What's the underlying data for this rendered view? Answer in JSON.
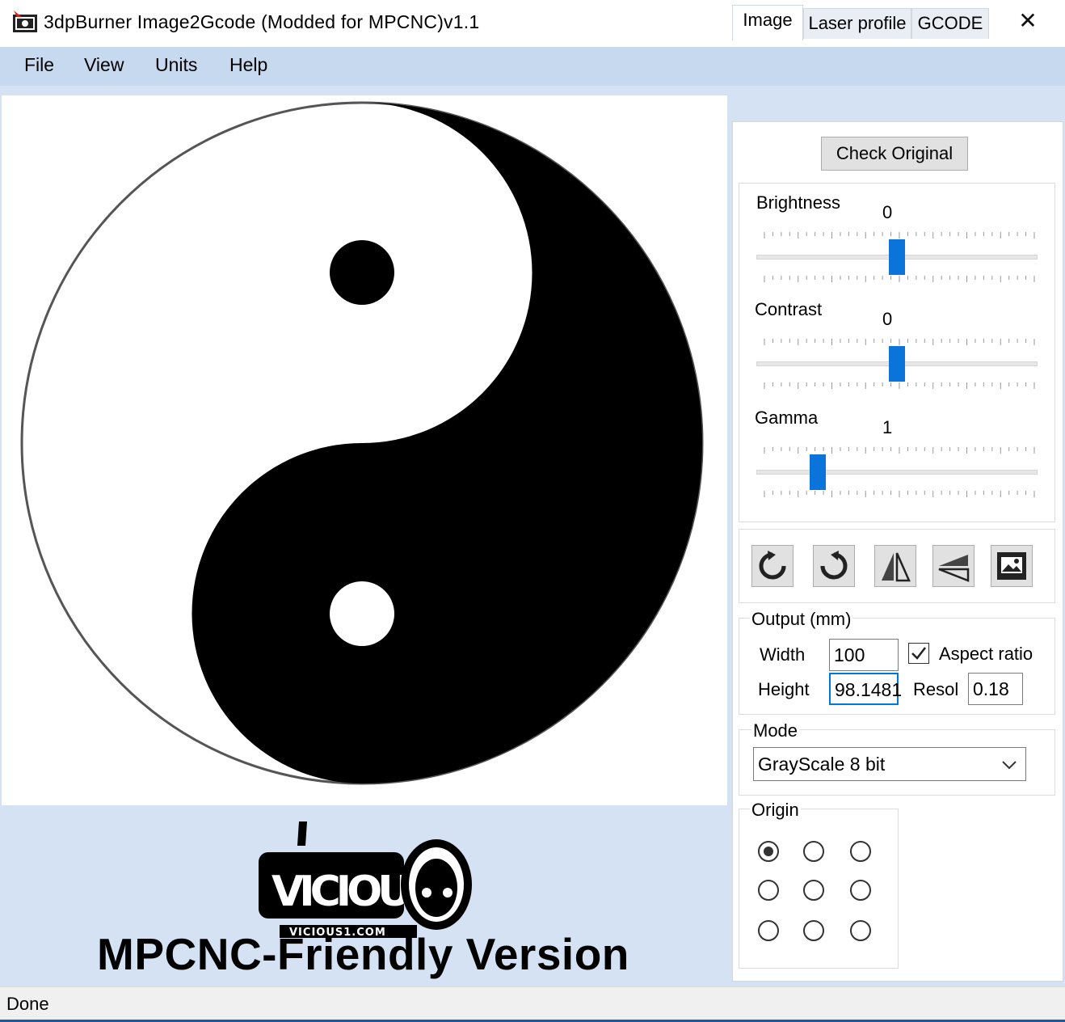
{
  "window": {
    "title": "3dpBurner Image2Gcode (Modded for MPCNC)v1.1",
    "minimize_glyph": "—",
    "maximize_glyph": "☐",
    "close_glyph": "✕",
    "icon": "app-icon"
  },
  "menu": [
    "File",
    "View",
    "Units",
    "Help"
  ],
  "canvas": {
    "image": "yin-yang-icon",
    "brand_logo": "vicious1-logo",
    "brand_logo_text": "VICIOUS1.COM",
    "brand_text": "MPCNC-Friendly Version"
  },
  "tabs": [
    {
      "label": "Image",
      "active": true
    },
    {
      "label": "Laser profile",
      "active": false
    },
    {
      "label": "GCODE",
      "active": false
    }
  ],
  "image_tab": {
    "check_original_label": "Check Original",
    "adjustments": [
      {
        "label": "Brightness",
        "value": "0",
        "level": 0.5
      },
      {
        "label": "Contrast",
        "value": "0",
        "level": 0.5
      },
      {
        "label": "Gamma",
        "value": "1",
        "level": 0.2
      }
    ],
    "tools": [
      "rotate-left-icon",
      "rotate-right-icon",
      "flip-horizontal-icon",
      "flip-vertical-icon",
      "invert-image-icon"
    ],
    "output": {
      "group_label": "Output (mm)",
      "width_label": "Width",
      "width_value": "100",
      "height_label": "Height",
      "height_value": "98.1481",
      "aspect_label": "Aspect ratio",
      "aspect_checked": true,
      "resol_label": "Resol",
      "resol_value": "0.18"
    },
    "mode": {
      "group_label": "Mode",
      "selected": "GrayScale 8 bit"
    },
    "origin": {
      "group_label": "Origin",
      "selected_index": 0
    }
  },
  "status": {
    "text": "Done",
    "accent": "#1b5aa6"
  },
  "colors": {
    "menubar": "#c6d9ef",
    "panel_bg": "#d4e2f3",
    "slider_thumb": "#0a74da"
  }
}
